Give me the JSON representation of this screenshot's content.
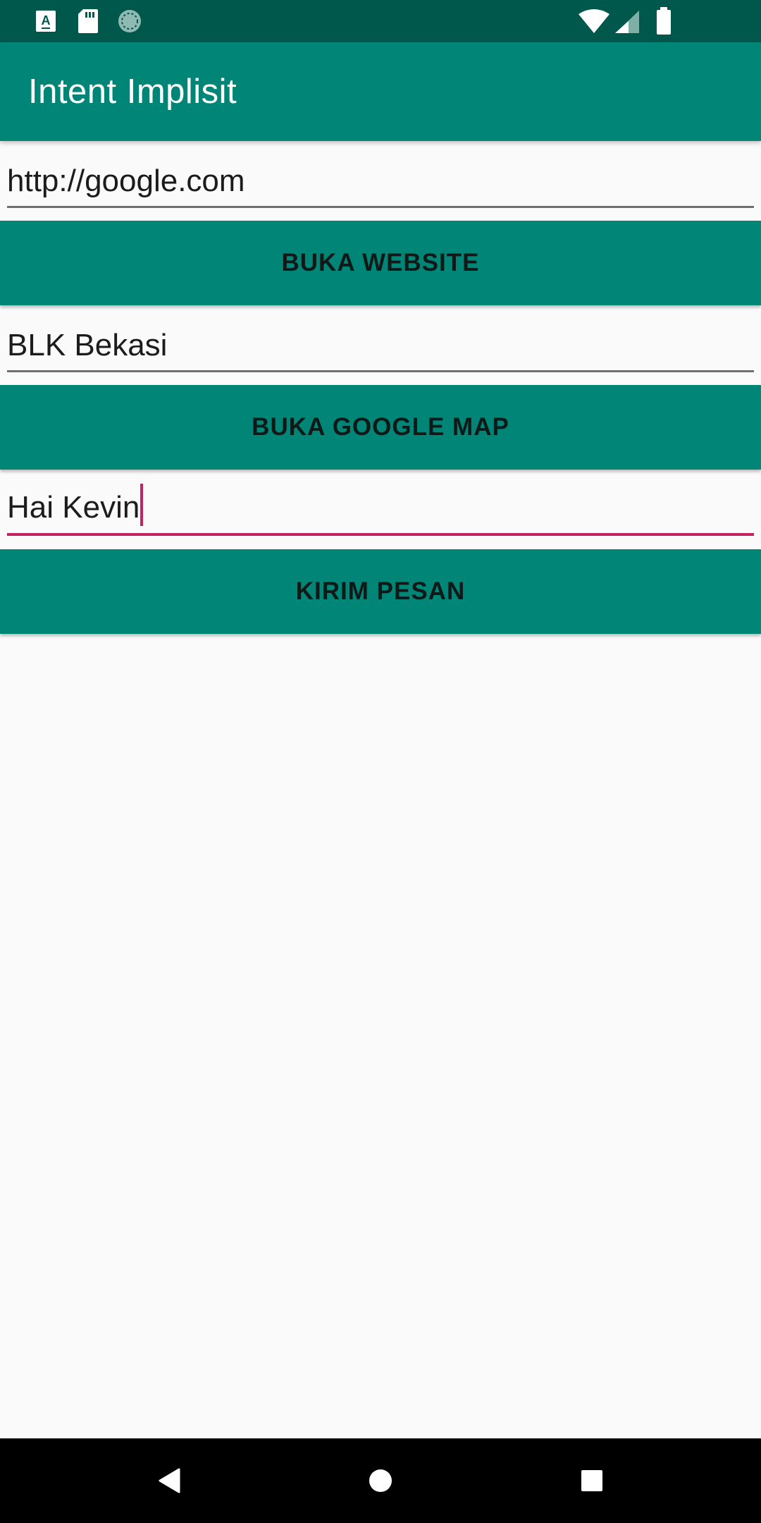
{
  "status_bar": {
    "left_icons": [
      "a-keyboard-icon",
      "sd-card-icon",
      "sync-icon"
    ],
    "right_icons": [
      "wifi-icon",
      "cellular-signal-icon",
      "battery-icon"
    ]
  },
  "app_bar": {
    "title": "Intent Implisit"
  },
  "form": {
    "url_value": "http://google.com",
    "open_website_label": "BUKA WEBSITE",
    "location_value": "BLK Bekasi",
    "open_map_label": "BUKA GOOGLE MAP",
    "message_value": "Hai Kevin",
    "send_message_label": "KIRIM PESAN"
  },
  "nav_bar": {
    "icons": [
      "back-icon",
      "home-icon",
      "recents-icon"
    ]
  },
  "colors": {
    "primary": "#008577",
    "primary_dark": "#00574b",
    "accent": "#c4235f",
    "background": "#fafafa"
  }
}
